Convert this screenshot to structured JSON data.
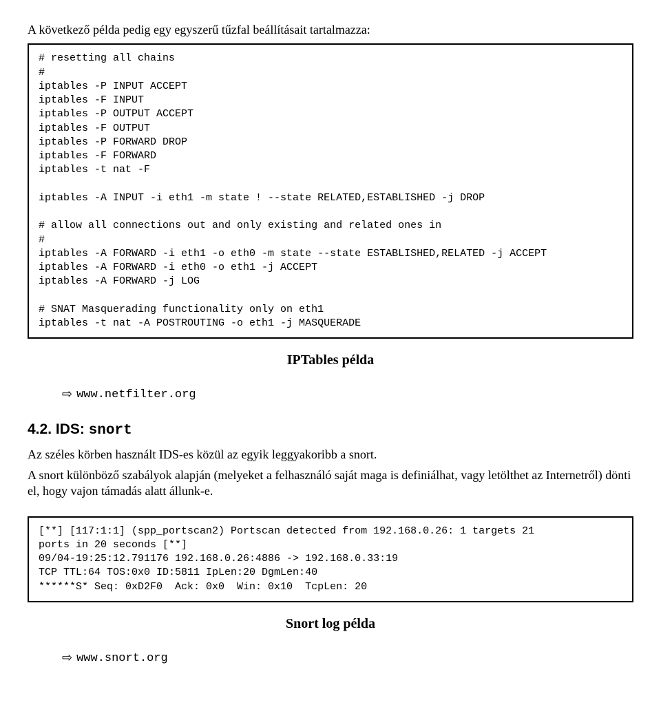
{
  "intro1": "A következő példa pedig egy egyszerű tűzfal beállításait tartalmazza:",
  "codebox1": "# resetting all chains\n#\niptables -P INPUT ACCEPT\niptables -F INPUT\niptables -P OUTPUT ACCEPT\niptables -F OUTPUT\niptables -P FORWARD DROP\niptables -F FORWARD\niptables -t nat -F\n\niptables -A INPUT -i eth1 -m state ! --state RELATED,ESTABLISHED -j DROP\n\n# allow all connections out and only existing and related ones in\n#\niptables -A FORWARD -i eth1 -o eth0 -m state --state ESTABLISHED,RELATED -j ACCEPT\niptables -A FORWARD -i eth0 -o eth1 -j ACCEPT\niptables -A FORWARD -j LOG\n\n# SNAT Masquerading functionality only on eth1\niptables -t nat -A POSTROUTING -o eth1 -j MASQUERADE",
  "caption1": "IPTables példa",
  "link1": "www.netfilter.org",
  "section": {
    "num": "4.2. IDS: ",
    "mono": "snort"
  },
  "para2": "Az széles körben használt IDS-es közül az egyik leggyakoribb a snort.",
  "para3": "A snort különböző szabályok alapján (melyeket a felhasználó saját maga is definiálhat, vagy letölthet az Internetről) dönti el, hogy vajon támadás alatt állunk-e.",
  "codebox2": "[**] [117:1:1] (spp_portscan2) Portscan detected from 192.168.0.26: 1 targets 21\nports in 20 seconds [**]\n09/04-19:25:12.791176 192.168.0.26:4886 -> 192.168.0.33:19\nTCP TTL:64 TOS:0x0 ID:5811 IpLen:20 DgmLen:40\n******S* Seq: 0xD2F0  Ack: 0x0  Win: 0x10  TcpLen: 20",
  "caption2": "Snort log példa",
  "link2": "www.snort.org"
}
